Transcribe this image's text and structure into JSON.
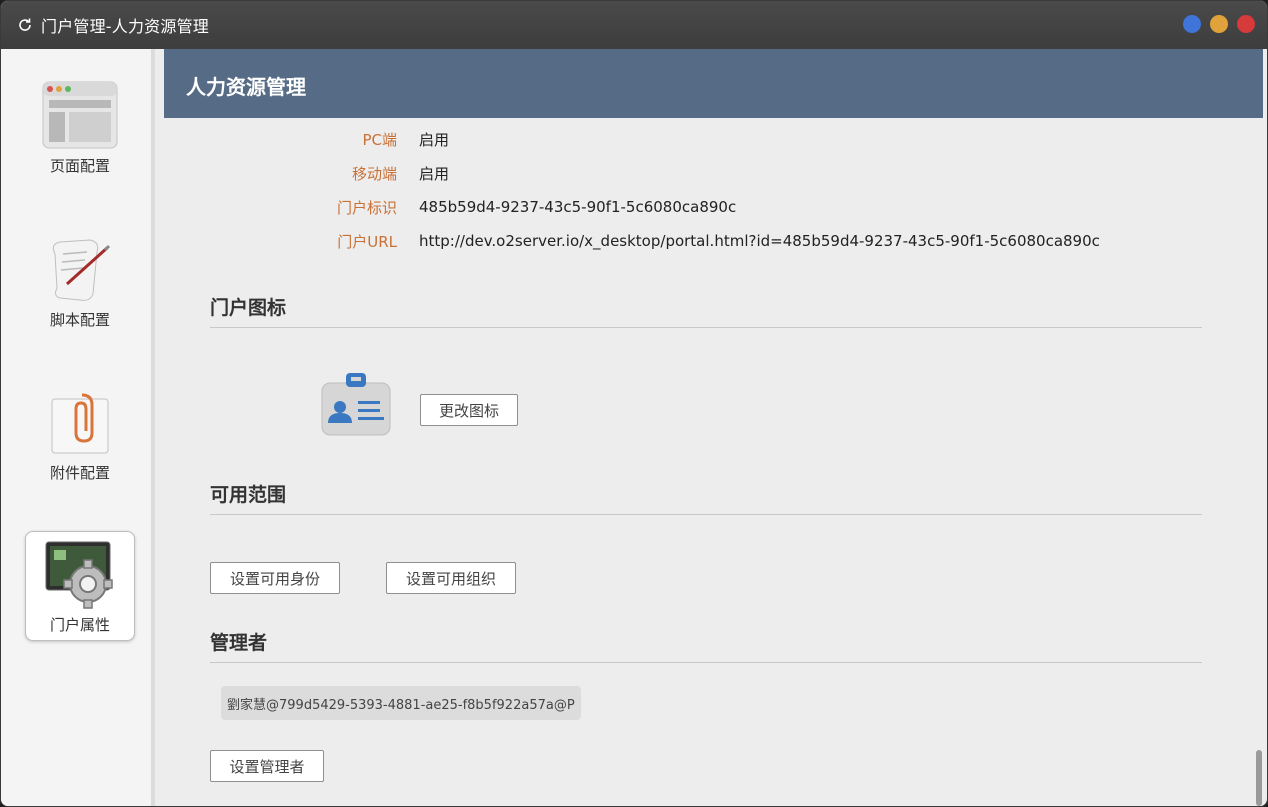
{
  "window": {
    "title": "门户管理-人力资源管理",
    "controls": [
      "#3f74d8",
      "#e0a23a",
      "#d63a3a"
    ]
  },
  "sidebar": {
    "items": [
      {
        "label": "页面配置",
        "icon": "page-layout-icon"
      },
      {
        "label": "脚本配置",
        "icon": "script-scroll-icon"
      },
      {
        "label": "附件配置",
        "icon": "paperclip-icon"
      },
      {
        "label": "门户属性",
        "icon": "gear-settings-icon",
        "active": true
      }
    ]
  },
  "main": {
    "header_title": "人力资源管理",
    "properties": [
      {
        "label": "PC端",
        "value": "启用"
      },
      {
        "label": "移动端",
        "value": "启用"
      },
      {
        "label": "门户标识",
        "value": "485b59d4-9237-43c5-90f1-5c6080ca890c"
      },
      {
        "label": "门户URL",
        "value": "http://dev.o2server.io/x_desktop/portal.html?id=485b59d4-9237-43c5-90f1-5c6080ca890c"
      }
    ],
    "icon_section": {
      "title": "门户图标",
      "change_button": "更改图标"
    },
    "scope_section": {
      "title": "可用范围",
      "identity_button": "设置可用身份",
      "org_button": "设置可用组织"
    },
    "admin_section": {
      "title": "管理者",
      "admin_tag": "劉家慧@799d5429-5393-4881-ae25-f8b5f922a57a@P",
      "set_button": "设置管理者"
    }
  },
  "colors": {
    "header_bg": "#566b86",
    "label_color": "#c87137"
  }
}
